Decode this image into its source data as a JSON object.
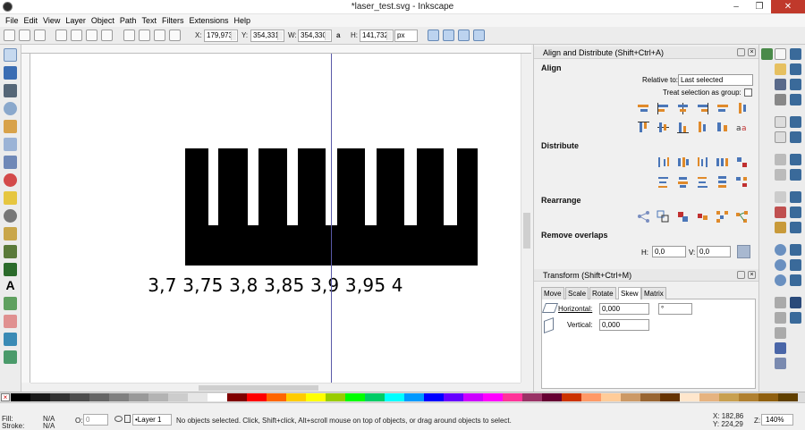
{
  "window": {
    "title": "*laser_test.svg - Inkscape",
    "minimize": "–",
    "restore": "❐",
    "close": "✕"
  },
  "menu": [
    "File",
    "Edit",
    "View",
    "Layer",
    "Object",
    "Path",
    "Text",
    "Filters",
    "Extensions",
    "Help"
  ],
  "toolctl": {
    "x_label": "X:",
    "x": "179,973",
    "y_label": "Y:",
    "y": "354,331",
    "w_label": "W:",
    "w": "354,330",
    "lock": "a",
    "h_label": "H:",
    "h": "141,732",
    "units": "px"
  },
  "canvas": {
    "scale_text": "3,7 3,75 3,8 3,85 3,9 3,95 4",
    "fill": "#000000"
  },
  "align_panel": {
    "title": "Align and Distribute (Shift+Ctrl+A)",
    "align": "Align",
    "relative_label": "Relative to:",
    "relative_value": "Last selected",
    "treat_group": "Treat selection as group:",
    "distribute": "Distribute",
    "rearrange": "Rearrange",
    "remove_overlaps": "Remove overlaps",
    "h_label": "H:",
    "h_value": "0,0",
    "v_label": "V:",
    "v_value": "0,0"
  },
  "transform_panel": {
    "title": "Transform (Shift+Ctrl+M)",
    "tabs": [
      "Move",
      "Scale",
      "Rotate",
      "Skew",
      "Matrix"
    ],
    "active_tab": "Skew",
    "horizontal_label": "Horizontal:",
    "horizontal": "0,000",
    "horizontal_unit": "°",
    "vertical_label": "Vertical:",
    "vertical": "0,000"
  },
  "status": {
    "fill_label": "Fill:",
    "fill": "N/A",
    "stroke_label": "Stroke:",
    "stroke": "N/A",
    "opacity_label": "O:",
    "opacity": "0",
    "layer": "•Layer 1",
    "message": "No objects selected. Click, Shift+click, Alt+scroll mouse on top of objects, or drag around objects to select.",
    "x": "X: 182,86",
    "y": "Y: 224,29",
    "zoom_label": "Z:",
    "zoom": "140%"
  },
  "palette": [
    "#000000",
    "#1a1a1a",
    "#333333",
    "#4d4d4d",
    "#666666",
    "#808080",
    "#999999",
    "#b3b3b3",
    "#cccccc",
    "#e6e6e6",
    "#ffffff",
    "#800000",
    "#ff0000",
    "#ff6600",
    "#ffcc00",
    "#ffff00",
    "#99cc00",
    "#00ff00",
    "#00cc66",
    "#00ffff",
    "#0099ff",
    "#0000ff",
    "#6600ff",
    "#cc00ff",
    "#ff00ff",
    "#ff3399",
    "#993366",
    "#660033",
    "#cc3300",
    "#ff9966",
    "#ffcc99",
    "#cc9966",
    "#996633",
    "#663300",
    "#ffe6cc",
    "#e6b380",
    "#c8a050",
    "#b08030",
    "#906010",
    "#604000"
  ]
}
